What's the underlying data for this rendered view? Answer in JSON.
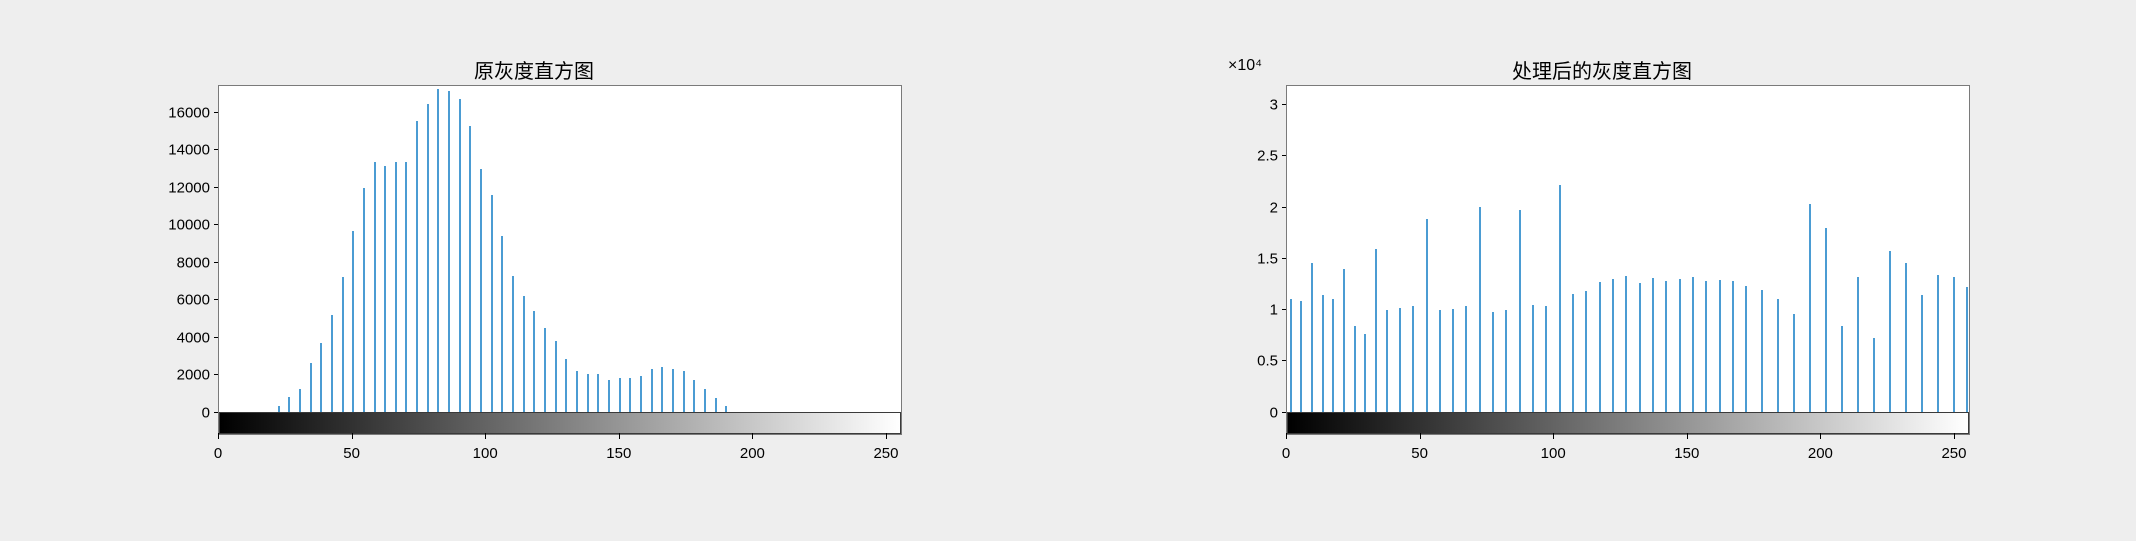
{
  "chart_data": [
    {
      "type": "bar",
      "title": "原灰度直方图",
      "xlabel": "",
      "ylabel": "",
      "xlim": [
        0,
        256
      ],
      "ylim": [
        0,
        17500
      ],
      "x_ticks": [
        0,
        50,
        100,
        150,
        200,
        250
      ],
      "y_ticks": [
        0,
        2000,
        4000,
        6000,
        8000,
        10000,
        12000,
        14000,
        16000
      ],
      "y_exponent": "",
      "x": [
        22,
        26,
        30,
        34,
        38,
        42,
        46,
        50,
        54,
        58,
        62,
        66,
        70,
        74,
        78,
        82,
        86,
        90,
        94,
        98,
        102,
        106,
        110,
        114,
        118,
        122,
        126,
        130,
        134,
        138,
        142,
        146,
        150,
        154,
        158,
        162,
        166,
        170,
        174,
        178,
        182,
        186,
        190
      ],
      "values": [
        300,
        800,
        1200,
        2600,
        3700,
        5200,
        7200,
        9700,
        12000,
        13400,
        13200,
        13400,
        13400,
        15600,
        16500,
        17300,
        17200,
        16800,
        15300,
        13000,
        11600,
        9400,
        7300,
        6200,
        5400,
        4500,
        3800,
        2800,
        2200,
        2000,
        2000,
        1700,
        1800,
        1800,
        1900,
        2300,
        2400,
        2300,
        2200,
        1700,
        1200,
        700,
        300
      ]
    },
    {
      "type": "bar",
      "title": "处理后的灰度直方图",
      "xlabel": "",
      "ylabel": "",
      "xlim": [
        0,
        256
      ],
      "ylim": [
        0,
        32000
      ],
      "x_ticks": [
        0,
        50,
        100,
        150,
        200,
        250
      ],
      "y_ticks": [
        0,
        5000,
        10000,
        15000,
        20000,
        25000,
        30000
      ],
      "y_tick_labels": [
        "0",
        "0.5",
        "1",
        "1.5",
        "2",
        "2.5",
        "3"
      ],
      "y_exponent": "×10⁴",
      "x": [
        1,
        5,
        9,
        13,
        17,
        21,
        25,
        29,
        33,
        37,
        42,
        47,
        52,
        57,
        62,
        67,
        72,
        77,
        82,
        87,
        92,
        97,
        102,
        107,
        112,
        117,
        122,
        127,
        132,
        137,
        142,
        147,
        152,
        157,
        162,
        167,
        172,
        178,
        184,
        190,
        196,
        202,
        208,
        214,
        220,
        226,
        232,
        238,
        244,
        250,
        255
      ],
      "values": [
        11000,
        10800,
        14600,
        11400,
        11000,
        14000,
        8400,
        7600,
        16000,
        10000,
        10200,
        10400,
        18900,
        10000,
        10100,
        10400,
        20100,
        9800,
        10000,
        19800,
        10500,
        10400,
        22200,
        11500,
        11800,
        12700,
        13000,
        13300,
        12600,
        13100,
        12800,
        13000,
        13200,
        12800,
        12900,
        12800,
        12300,
        11900,
        11000,
        9600,
        20400,
        18000,
        8400,
        13200,
        7200,
        15800,
        14600,
        11400,
        13400,
        13200,
        12200
      ]
    }
  ],
  "panels": [
    {
      "title_path": "chart_data.0.title",
      "exp_path": "chart_data.0.y_exponent"
    },
    {
      "title_path": "chart_data.1.title",
      "exp_path": "chart_data.1.y_exponent"
    }
  ]
}
